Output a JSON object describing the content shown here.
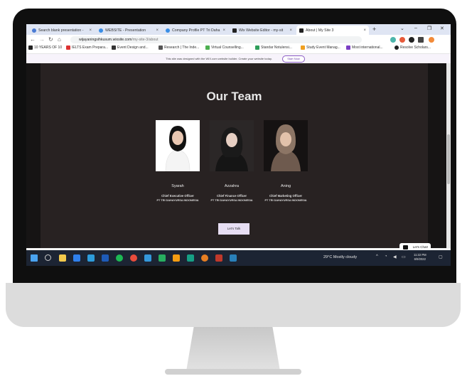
{
  "tabs": [
    {
      "label": "Search blank presentation -"
    },
    {
      "label": "WEBSITE - Presentation"
    },
    {
      "label": "Company Profile PT Tri Daha"
    },
    {
      "label": "Wix Website Editor - my-sit"
    },
    {
      "label": "About | My Site 3"
    }
  ],
  "newtab": "+",
  "address": {
    "host": "wijayaningsihkusum.wixsite.com",
    "path": "/my-site-3/about"
  },
  "bookmarks": [
    "10 YEARS OF 10",
    "IELTS Exam Prepara...",
    "Event Design and...",
    "Research | The Inde...",
    "Virtual Counselling...",
    "Standar Notulensi...",
    "Study Event Manag...",
    "Most international...",
    "Resolve Scholars..."
  ],
  "banner": {
    "text": "This site was designed with the WIX.com website builder. Create your website today.",
    "button": "Start Now"
  },
  "page": {
    "heading": "Our Team",
    "members": [
      {
        "name": "Syarah",
        "role": "Chief Executive Officer",
        "company": "PT TRI DAHAYURSA INDONESIA"
      },
      {
        "name": "Azzahra",
        "role": "Chief Finance Officer",
        "company": "PT TRI DAHAYURSA INDONESIA"
      },
      {
        "name": "Aning",
        "role": "Chief Marketing Officer",
        "company": "PT TRI DAHAYURSA INDONESIA"
      }
    ],
    "cta": "Let's Talk",
    "chat": "Let's Chat!"
  },
  "taskbar": {
    "weather": "29°C  Mostly cloudy",
    "time": "11:22 PM",
    "date": "6/9/2022"
  },
  "colors": {
    "page_bg": "#282222",
    "accent": "#8a5bc4",
    "taskbar": "#1c2433"
  }
}
